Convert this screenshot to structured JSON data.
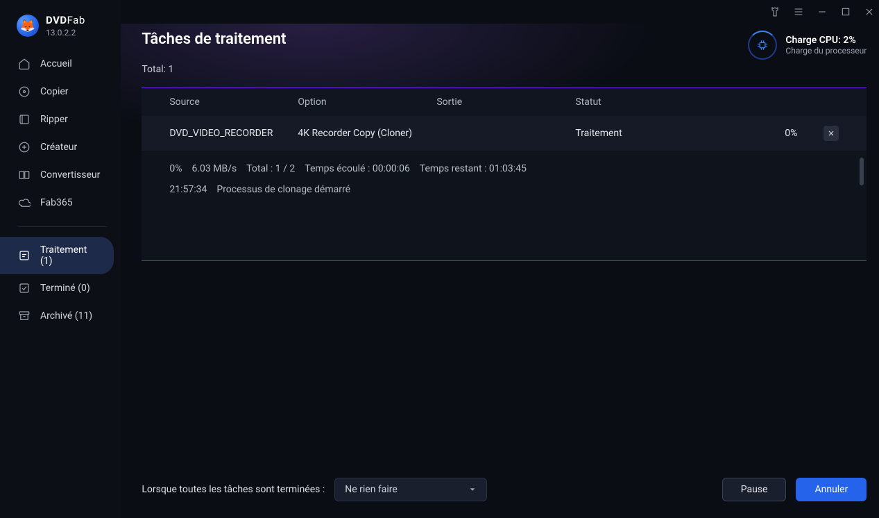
{
  "app": {
    "brand_bold": "DVD",
    "brand_light": "Fab",
    "version": "13.0.2.2"
  },
  "sidebar": {
    "items": [
      {
        "label": "Accueil"
      },
      {
        "label": "Copier"
      },
      {
        "label": "Ripper"
      },
      {
        "label": "Créateur"
      },
      {
        "label": "Convertisseur"
      },
      {
        "label": "Fab365"
      }
    ],
    "queue": [
      {
        "label": "Traitement (1)"
      },
      {
        "label": "Terminé (0)"
      },
      {
        "label": "Archivé (11)"
      }
    ]
  },
  "header": {
    "title": "Tâches de traitement",
    "total_label": "Total: 1",
    "cpu_title": "Charge CPU: 2%",
    "cpu_sub": "Charge du processeur"
  },
  "table": {
    "cols": {
      "source": "Source",
      "option": "Option",
      "output": "Sortie",
      "status": "Statut"
    },
    "row": {
      "source": "DVD_VIDEO_RECORDER",
      "option": "4K Recorder Copy (Cloner)",
      "output": "",
      "status": "Traitement",
      "percent": "0%"
    },
    "details": {
      "line1": {
        "pct": "0%",
        "speed": "6.03 MB/s",
        "total": "Total : 1 / 2",
        "elapsed": "Temps écoulé : 00:00:06",
        "remain": "Temps restant : 01:03:45"
      },
      "line2": {
        "time": "21:57:34",
        "msg": "Processus de clonage démarré"
      }
    }
  },
  "footer": {
    "label": "Lorsque toutes les tâches sont terminées :",
    "select_value": "Ne rien faire",
    "pause": "Pause",
    "cancel": "Annuler"
  }
}
